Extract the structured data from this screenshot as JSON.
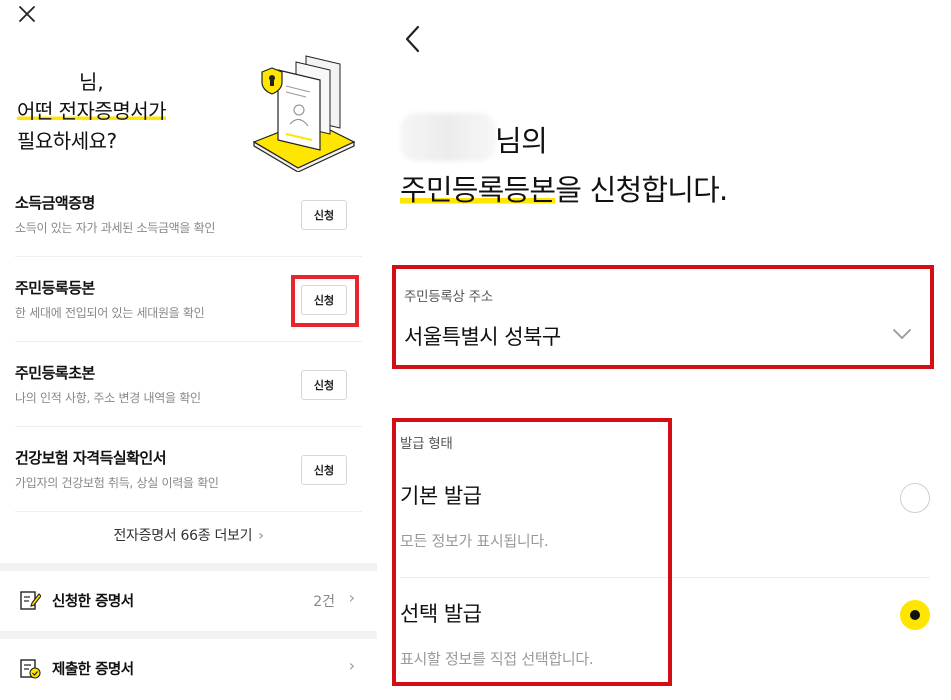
{
  "left_panel": {
    "greeting": {
      "name_suffix": "님,",
      "line1": "어떤 전자증명서가",
      "line2": "필요하세요?"
    },
    "certificates": [
      {
        "title": "소득금액증명",
        "desc": "소득이 있는 자가 과세된 소득금액을 확인",
        "button": "신청"
      },
      {
        "title": "주민등록등본",
        "desc": "한 세대에 전입되어 있는 세대원을 확인",
        "button": "신청"
      },
      {
        "title": "주민등록초본",
        "desc": "나의 인적 사항, 주소 변경 내역을 확인",
        "button": "신청"
      },
      {
        "title": "건강보험 자격득실확인서",
        "desc": "가입자의 건강보험 취득, 상실 이력을 확인",
        "button": "신청"
      }
    ],
    "more_link": "전자증명서 66종 더보기",
    "menu": [
      {
        "label": "신청한 증명서",
        "count": "2건",
        "icon": "edit-document-icon"
      },
      {
        "label": "제출한 증명서",
        "count": "",
        "icon": "submitted-document-icon"
      }
    ]
  },
  "right_panel": {
    "headline_suffix": "님의",
    "headline_highlight": "주민등록등본",
    "headline_rest": "을 신청합니다.",
    "address": {
      "label": "주민등록상 주소",
      "value": "서울특별시 성북구"
    },
    "issue_type": {
      "label": "발급 형태",
      "options": [
        {
          "title": "기본 발급",
          "desc": "모든 정보가 표시됩니다.",
          "selected": false
        },
        {
          "title": "선택 발급",
          "desc": "표시할 정보를 직접 선택합니다.",
          "selected": true
        }
      ]
    }
  },
  "colors": {
    "accent_yellow": "#ffe600",
    "annotation_red": "#d10f15",
    "annotation_pink_red": "#e8252f"
  }
}
